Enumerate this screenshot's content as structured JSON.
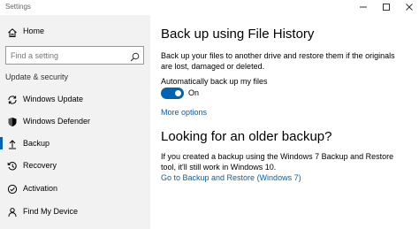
{
  "window": {
    "title": "Settings"
  },
  "sidebar": {
    "home_label": "Home",
    "search_placeholder": "Find a setting",
    "section_label": "Update & security",
    "items": [
      {
        "label": "Windows Update",
        "icon": "sync-icon"
      },
      {
        "label": "Windows Defender",
        "icon": "shield-icon"
      },
      {
        "label": "Backup",
        "icon": "upload-arrow-icon",
        "active": true
      },
      {
        "label": "Recovery",
        "icon": "history-icon"
      },
      {
        "label": "Activation",
        "icon": "checkmark-circle-icon"
      },
      {
        "label": "Find My Device",
        "icon": "person-pin-icon"
      }
    ]
  },
  "main": {
    "title": "Back up using File History",
    "description": "Back up your files to another drive and restore them if the originals are lost, damaged or deleted.",
    "auto_backup_label": "Automatically back up my files",
    "toggle_state": "On",
    "more_options": "More options",
    "older_title": "Looking for an older backup?",
    "older_description": "If you created a backup using the Windows 7 Backup and Restore tool, it'll still work in Windows 10.",
    "older_link": "Go to Backup and Restore (Windows 7)"
  },
  "colors": {
    "accent": "#0063b1",
    "sidebar_bg": "#f2f2f2"
  }
}
